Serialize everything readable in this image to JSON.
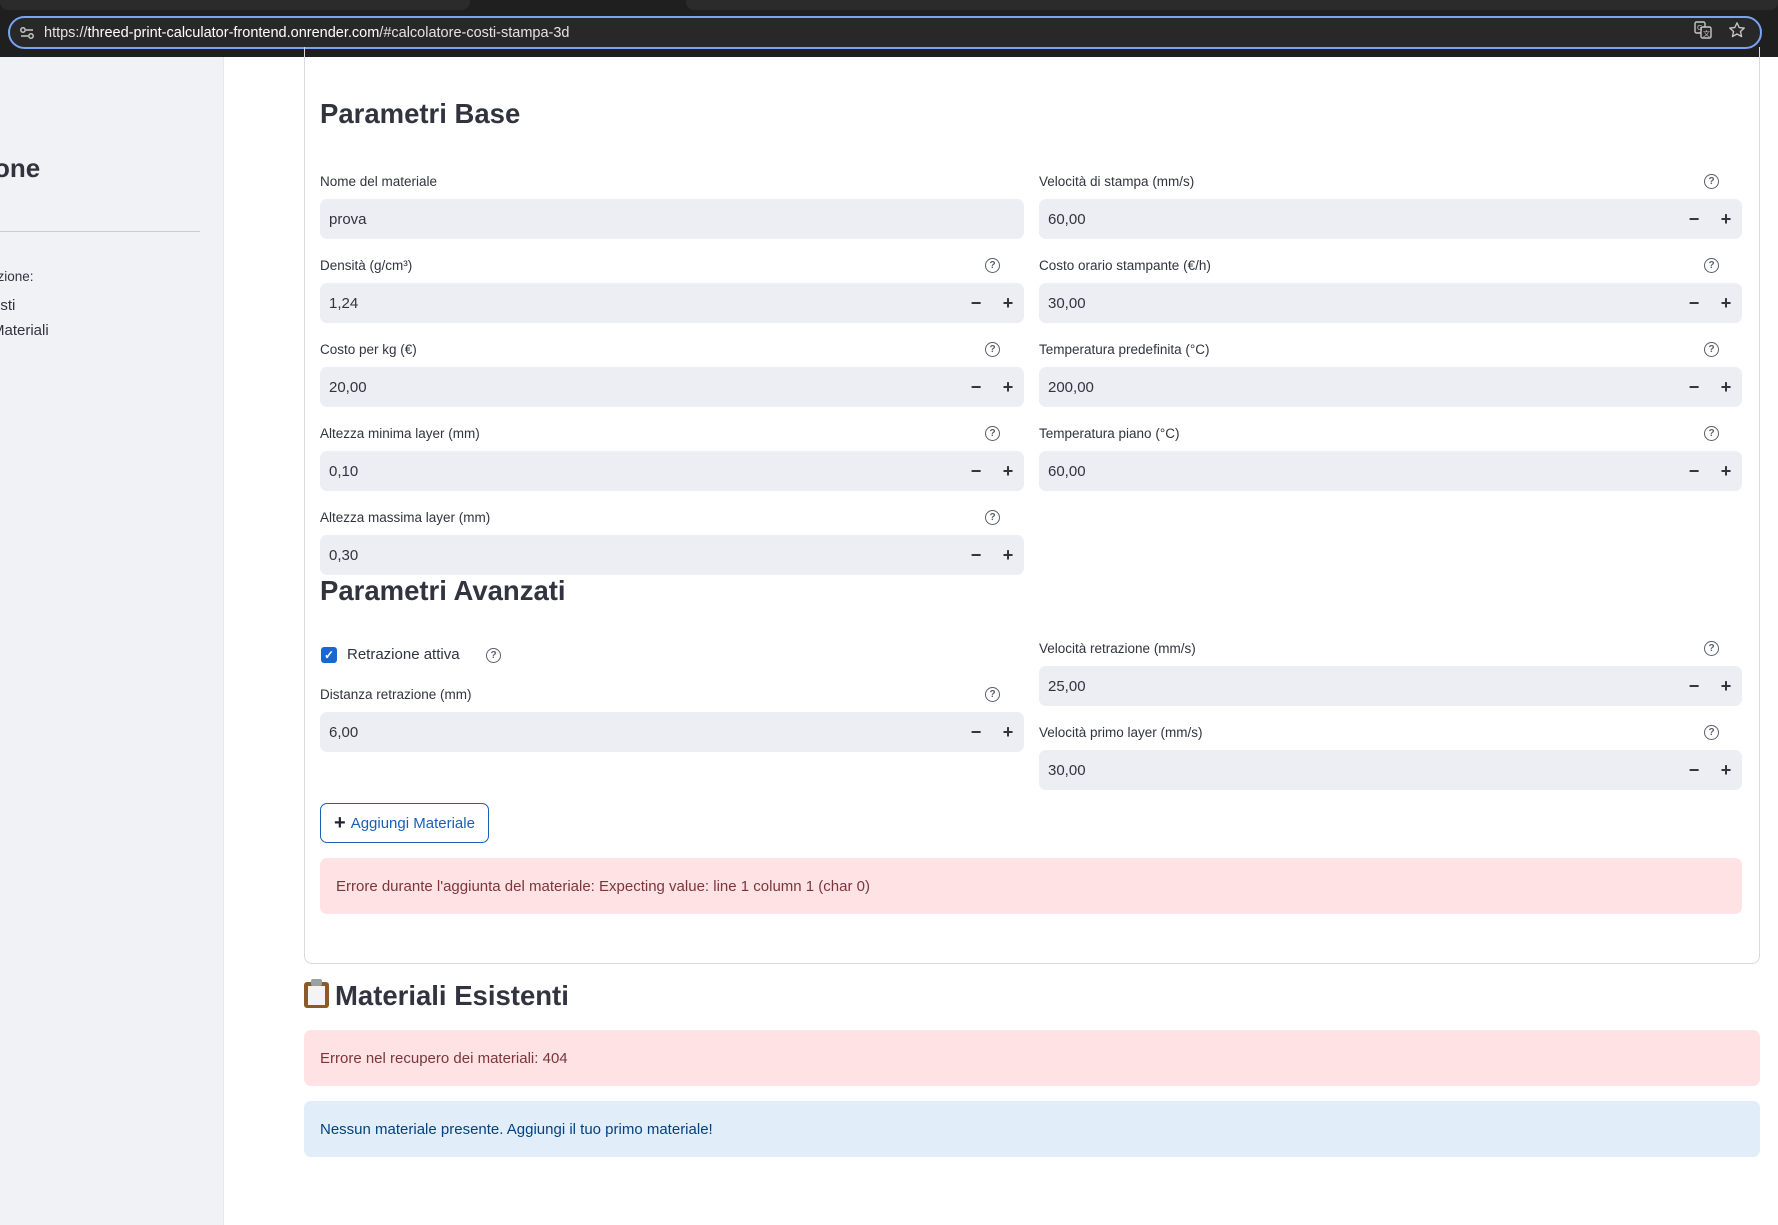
{
  "browser": {
    "url_prefix": "https://",
    "url_host": "threed-print-calculator-frontend.onrender.com",
    "url_path": "/#calcolatore-costi-stampa-3d"
  },
  "sidebar": {
    "title": "one",
    "label": "ezione:",
    "options": [
      "osti",
      "Materiali"
    ]
  },
  "base_section": {
    "heading": "Parametri Base",
    "fields": {
      "material_name": {
        "label": "Nome del materiale",
        "value": "prova"
      },
      "print_speed": {
        "label": "Velocità di stampa (mm/s)",
        "value": "60,00"
      },
      "density": {
        "label": "Densità (g/cm³)",
        "value": "1,24"
      },
      "hourly_cost": {
        "label": "Costo orario stampante (€/h)",
        "value": "30,00"
      },
      "cost_per_kg": {
        "label": "Costo per kg (€)",
        "value": "20,00"
      },
      "default_temp": {
        "label": "Temperatura predefinita (°C)",
        "value": "200,00"
      },
      "min_layer": {
        "label": "Altezza minima layer (mm)",
        "value": "0,10"
      },
      "bed_temp": {
        "label": "Temperatura piano (°C)",
        "value": "60,00"
      },
      "max_layer": {
        "label": "Altezza massima layer (mm)",
        "value": "0,30"
      }
    }
  },
  "advanced_section": {
    "heading": "Parametri Avanzati",
    "retraction_checkbox": {
      "label": "Retrazione attiva",
      "checked": true
    },
    "fields": {
      "retraction_distance": {
        "label": "Distanza retrazione (mm)",
        "value": "6,00"
      },
      "retraction_speed": {
        "label": "Velocità retrazione (mm/s)",
        "value": "25,00"
      },
      "first_layer_speed": {
        "label": "Velocità primo layer (mm/s)",
        "value": "30,00"
      }
    }
  },
  "add_button_label": "Aggiungi Materiale",
  "add_error": "Errore durante l'aggiunta del materiale: Expecting value: line 1 column 1 (char 0)",
  "existing": {
    "heading": "Materiali Esistenti",
    "error": "Errore nel recupero dei materiali: 404",
    "info": "Nessun materiale presente. Aggiungi il tuo primo materiale!"
  },
  "stepper": {
    "minus": "−",
    "plus": "+"
  },
  "icons": {
    "help": "question-circle-icon",
    "checkbox": "checkmark-icon",
    "add": "plus-icon",
    "clipboard": "clipboard-icon",
    "site_settings": "tune-icon",
    "translate": "translate-icon",
    "bookmark": "star-icon"
  },
  "colors": {
    "accent": "#1967d2",
    "error_bg": "#ffe3e4",
    "info_bg": "#e1edf9",
    "sidebar_bg": "#f0f2f6",
    "input_bg": "#eceef3"
  }
}
